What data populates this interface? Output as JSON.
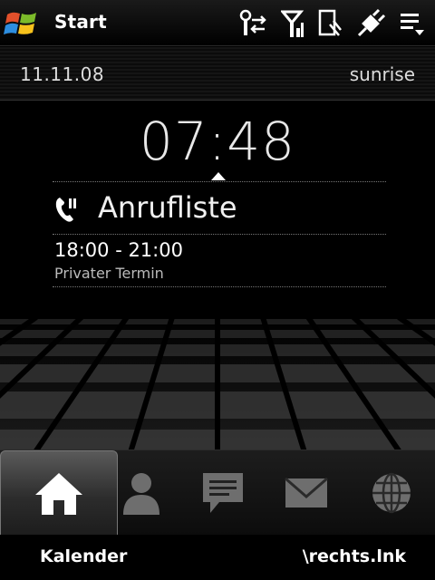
{
  "titlebar": {
    "title": "Start",
    "start_icon": "windows-flag-icon"
  },
  "status_icons": [
    "connectivity-icon",
    "signal-icon",
    "sync-icon",
    "battery-plug-icon",
    "menu-icon"
  ],
  "home": {
    "date": "11.11.08",
    "profile": "sunrise",
    "clock": "07:48",
    "call_log": {
      "label": "Anrufliste",
      "icon": "phone-icon"
    },
    "appointment": {
      "time": "18:00 - 21:00",
      "title": "Privater Termin"
    }
  },
  "tabs": [
    {
      "name": "home",
      "icon": "home-icon",
      "active": true
    },
    {
      "name": "people",
      "icon": "person-icon",
      "active": false
    },
    {
      "name": "messages",
      "icon": "message-icon",
      "active": false
    },
    {
      "name": "email",
      "icon": "mail-icon",
      "active": false
    },
    {
      "name": "internet",
      "icon": "globe-icon",
      "active": false
    }
  ],
  "softkeys": {
    "left": "Kalender",
    "right": "\\rechts.lnk"
  },
  "colors": {
    "background": "#000000",
    "text": "#ffffff",
    "muted": "#bbbbbb"
  }
}
